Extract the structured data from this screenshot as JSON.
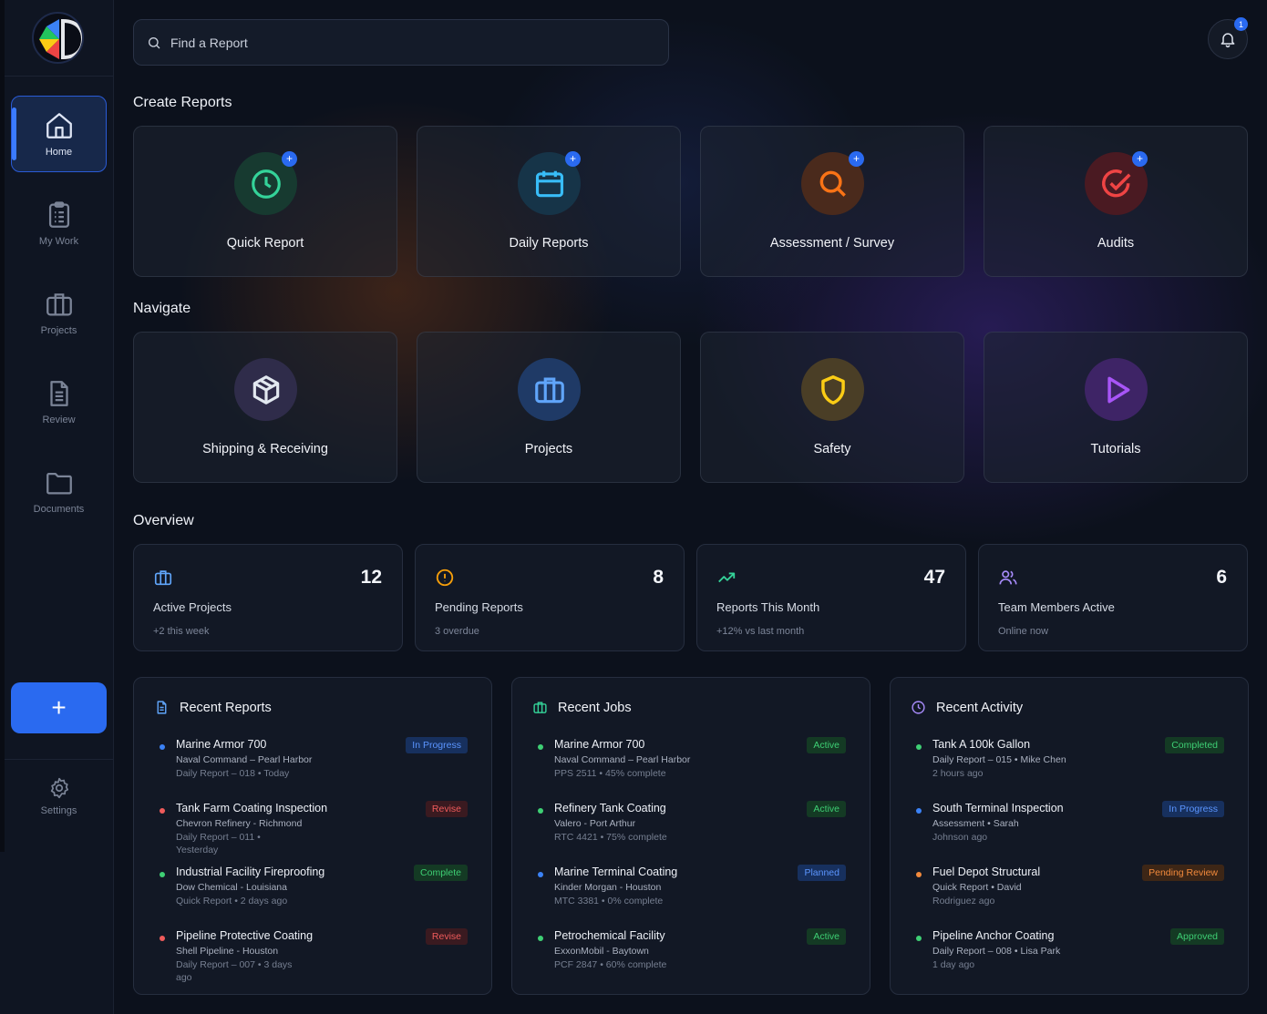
{
  "sidebar": {
    "items": [
      {
        "label": "Home",
        "icon": "home-icon"
      },
      {
        "label": "My Work",
        "icon": "clipboard-icon"
      },
      {
        "label": "Projects",
        "icon": "briefcase-icon"
      },
      {
        "label": "Review",
        "icon": "document-icon"
      },
      {
        "label": "Documents",
        "icon": "folder-icon"
      }
    ],
    "add_label": "+",
    "settings_label": "Settings"
  },
  "header": {
    "search_placeholder": "Find a Report",
    "notification_count": "1"
  },
  "create_reports": {
    "title": "Create Reports",
    "tiles": [
      {
        "label": "Quick Report",
        "icon": "clock-icon",
        "color": "#34d399"
      },
      {
        "label": "Daily Reports",
        "icon": "calendar-icon",
        "color": "#38bdf8"
      },
      {
        "label": "Assessment / Survey",
        "icon": "search-icon",
        "color": "#f97316"
      },
      {
        "label": "Audits",
        "icon": "check-circle-icon",
        "color": "#ef4444"
      }
    ],
    "plus_label": "+"
  },
  "navigate": {
    "title": "Navigate",
    "tiles": [
      {
        "label": "Shipping & Receiving",
        "icon": "box-icon",
        "color": "#e2e8f0"
      },
      {
        "label": "Projects",
        "icon": "briefcase-icon",
        "color": "#60a5fa"
      },
      {
        "label": "Safety",
        "icon": "shield-icon",
        "color": "#facc15"
      },
      {
        "label": "Tutorials",
        "icon": "play-icon",
        "color": "#a855f7"
      }
    ]
  },
  "overview": {
    "title": "Overview",
    "stats": [
      {
        "value": "12",
        "title": "Active Projects",
        "sub": "+2 this week",
        "icon": "briefcase-icon",
        "color": "#60a5fa"
      },
      {
        "value": "8",
        "title": "Pending Reports",
        "sub": "3 overdue",
        "icon": "alert-circle-icon",
        "color": "#f59e0b"
      },
      {
        "value": "47",
        "title": "Reports This Month",
        "sub": "+12% vs last month",
        "icon": "trending-up-icon",
        "color": "#34d399"
      },
      {
        "value": "6",
        "title": "Team Members Active",
        "sub": "Online now",
        "icon": "users-icon",
        "color": "#a78bfa"
      }
    ]
  },
  "recent_reports": {
    "title": "Recent Reports",
    "rows": [
      {
        "title": "Marine Armor 700",
        "sub1": "Naval Command – Pearl Harbor",
        "sub2": "Daily Report – 018 • Today",
        "badge": "In Progress",
        "status": "blue"
      },
      {
        "title": "Tank Farm Coating Inspection",
        "sub1": "Chevron Refinery - Richmond",
        "sub2": "Daily Report – 011 • Yesterday",
        "badge": "Revise",
        "status": "red"
      },
      {
        "title": "Industrial Facility Fireproofing",
        "sub1": "Dow Chemical - Louisiana",
        "sub2": "Quick Report • 2 days ago",
        "badge": "Complete",
        "status": "green"
      },
      {
        "title": "Pipeline Protective Coating",
        "sub1": "Shell Pipeline - Houston",
        "sub2": "Daily Report – 007 • 3 days ago",
        "badge": "Revise",
        "status": "red"
      }
    ]
  },
  "recent_jobs": {
    "title": "Recent Jobs",
    "rows": [
      {
        "title": "Marine Armor 700",
        "sub1": "Naval Command – Pearl Harbor",
        "sub2": "PPS 2511 • 45% complete",
        "badge": "Active",
        "status": "green"
      },
      {
        "title": "Refinery Tank Coating",
        "sub1": "Valero - Port Arthur",
        "sub2": "RTC 4421 • 75% complete",
        "badge": "Active",
        "status": "green"
      },
      {
        "title": "Marine Terminal Coating",
        "sub1": "Kinder Morgan - Houston",
        "sub2": "MTC 3381 • 0% complete",
        "badge": "Planned",
        "status": "blue"
      },
      {
        "title": "Petrochemical Facility",
        "sub1": "ExxonMobil - Baytown",
        "sub2": "PCF 2847 • 60% complete",
        "badge": "Active",
        "status": "green"
      }
    ]
  },
  "recent_activity": {
    "title": "Recent Activity",
    "rows": [
      {
        "title": "Tank A 100k Gallon",
        "sub1": "Daily Report – 015 • Mike Chen",
        "sub2": "2 hours ago",
        "badge": "Completed",
        "status": "green"
      },
      {
        "title": "South Terminal Inspection",
        "sub1": "Assessment • Sarah",
        "sub2": "Johnson ago",
        "badge": "In Progress",
        "status": "blue"
      },
      {
        "title": "Fuel Depot Structural",
        "sub1": "Quick Report • David",
        "sub2": "Rodriguez ago",
        "badge": "Pending Review",
        "status": "orange"
      },
      {
        "title": "Pipeline Anchor Coating",
        "sub1": "Daily Report – 008 • Lisa Park",
        "sub2": "1 day ago",
        "badge": "Approved",
        "status": "green"
      }
    ]
  }
}
